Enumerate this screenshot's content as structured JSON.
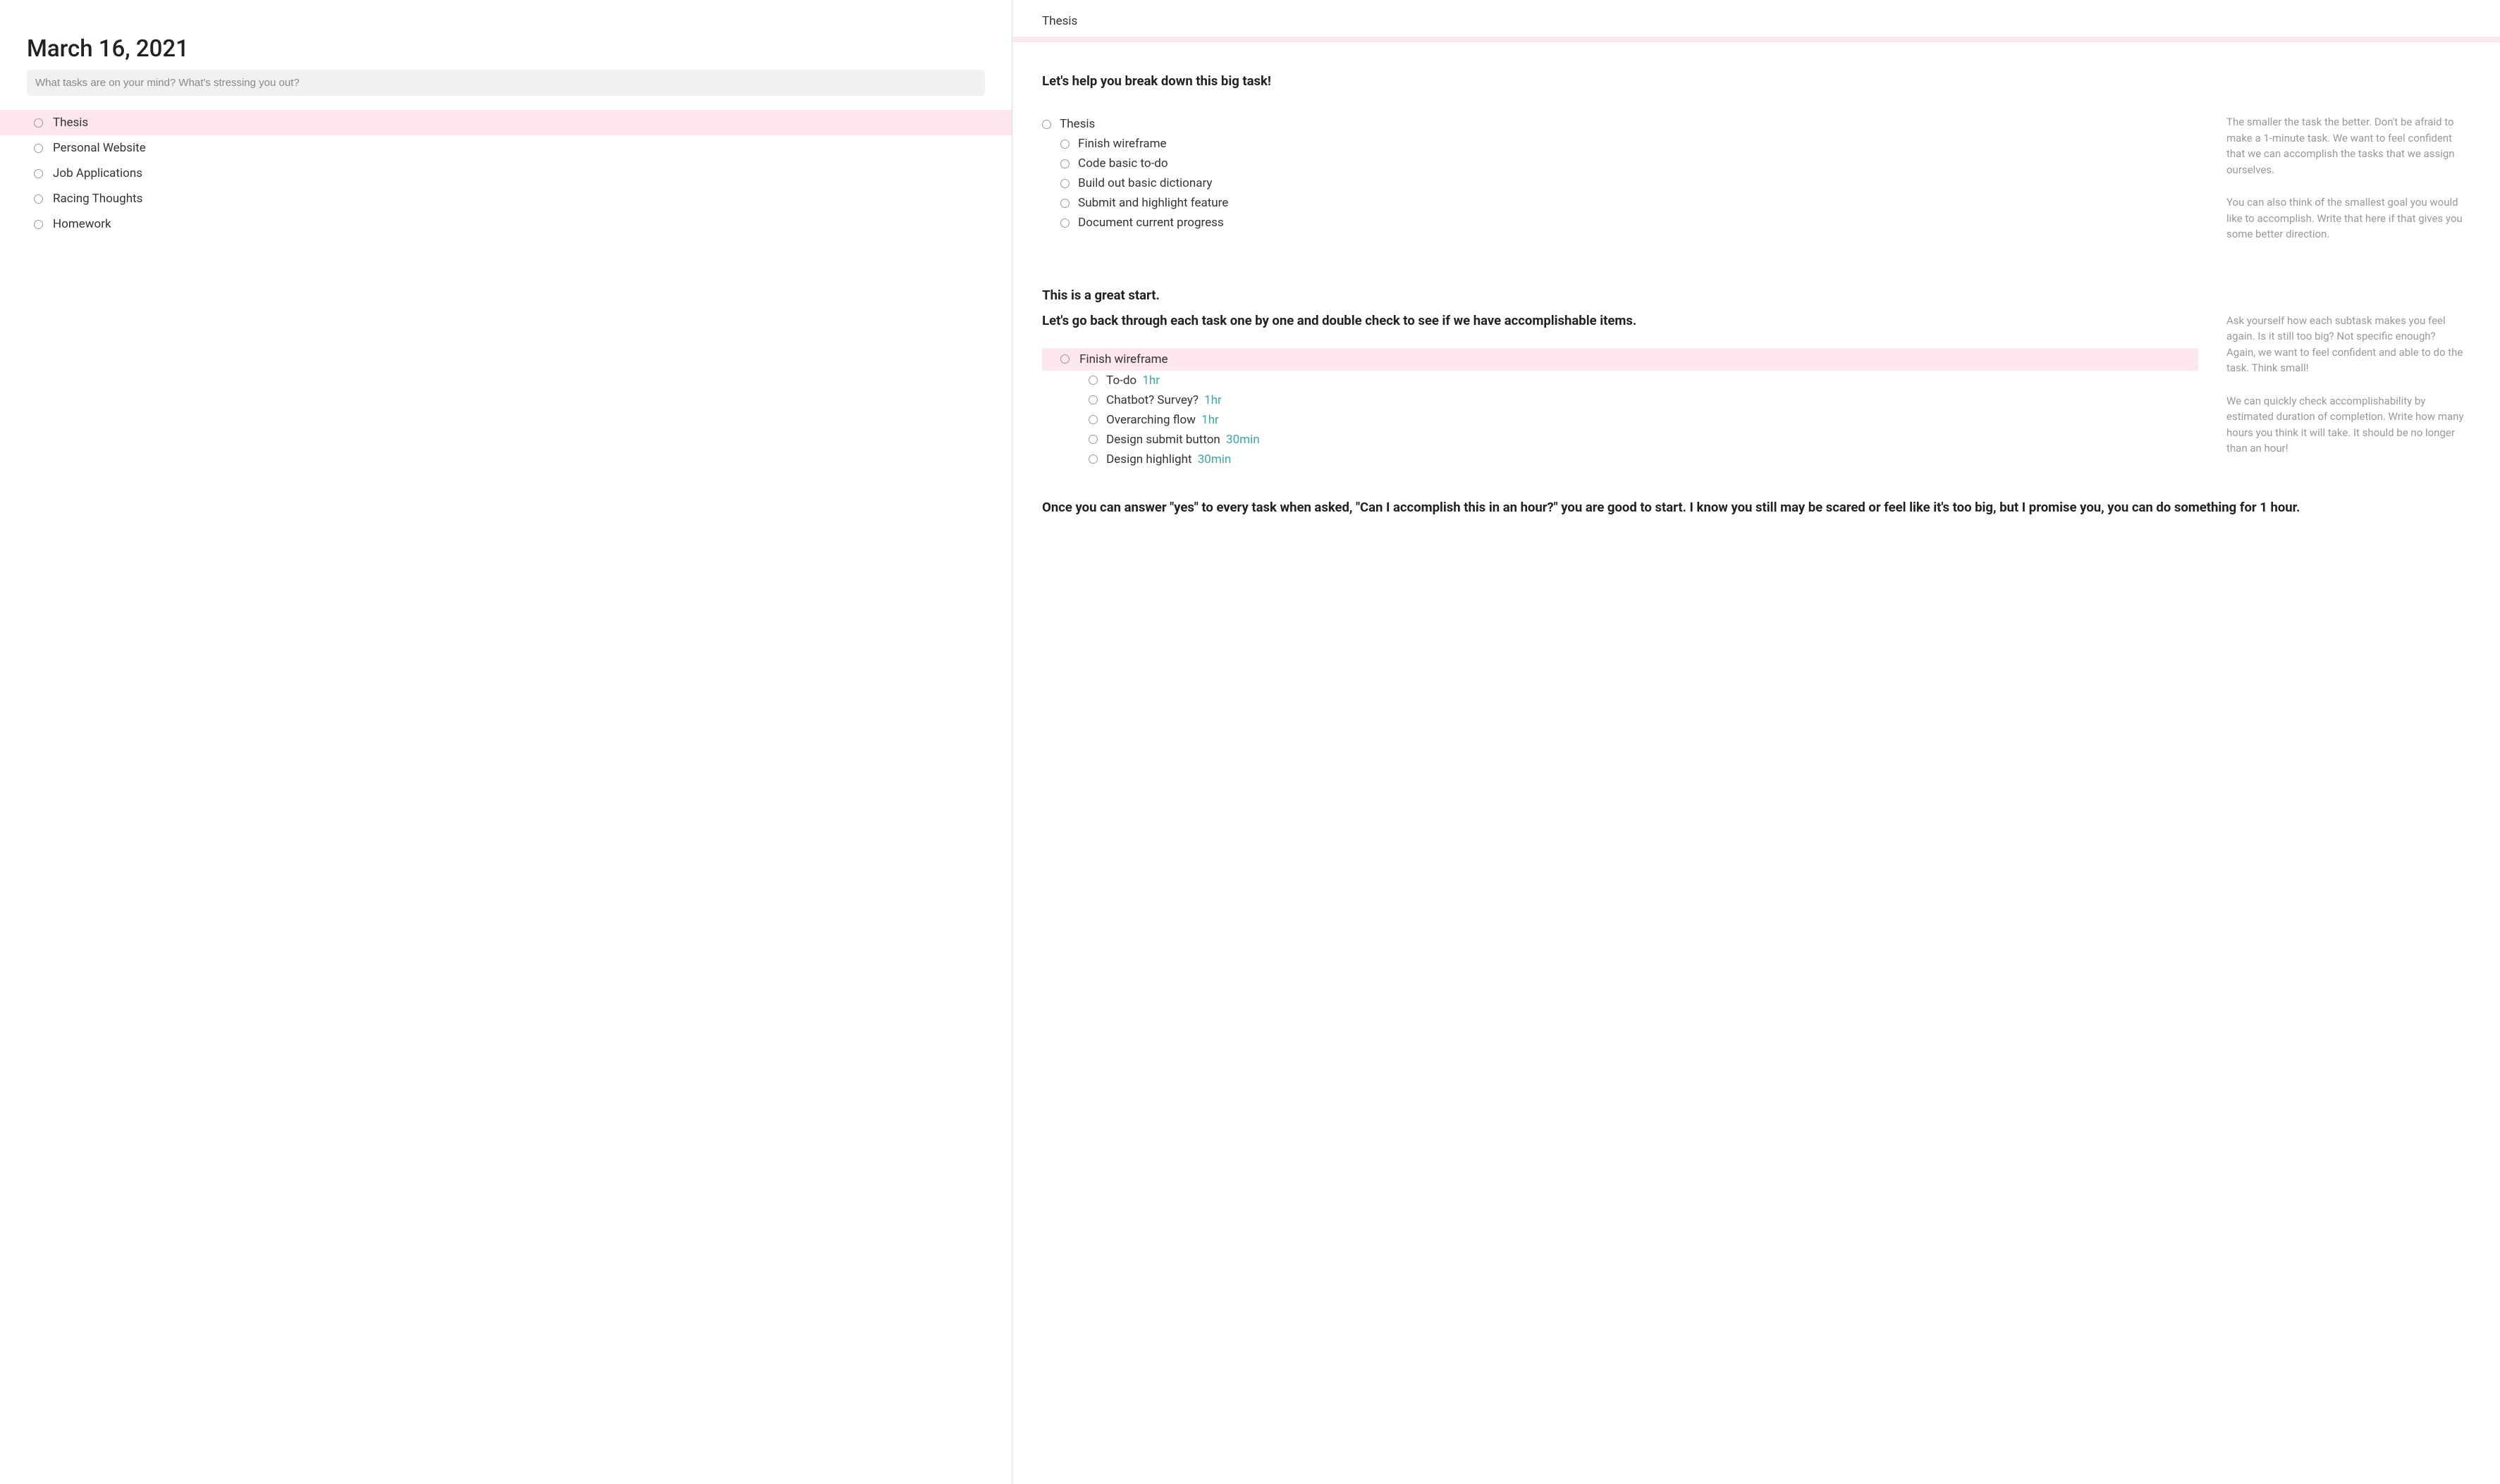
{
  "date": "March 16, 2021",
  "input_placeholder": "What tasks are on your mind? What's stressing you out?",
  "sidebar_tasks": [
    {
      "label": "Thesis",
      "selected": true
    },
    {
      "label": "Personal Website",
      "selected": false
    },
    {
      "label": "Job Applications",
      "selected": false
    },
    {
      "label": "Racing Thoughts",
      "selected": false
    },
    {
      "label": "Homework",
      "selected": false
    }
  ],
  "right_header": "Thesis",
  "section1": {
    "heading": "Let's help you break down this big task!",
    "parent": "Thesis",
    "subtasks": [
      "Finish wireframe",
      "Code basic to-do",
      "Build out basic dictionary",
      "Submit and highlight feature",
      "Document current progress"
    ],
    "hint1": "The smaller the task the better. Don't be afraid to make a 1-minute task. We want to feel confident that we can accomplish the tasks that we assign ourselves.",
    "hint2": "You can also think of the smallest goal you would like to accomplish. Write that here if that gives you some better direction."
  },
  "section2": {
    "heading1": "This is a great start.",
    "heading2": "Let's go back through each task one by one and double check to see if we have accomplishable items.",
    "hint1": "Ask yourself how each subtask makes you feel again. Is it still too big? Not specific enough? Again, we want to feel confident and able to do the task. Think small!",
    "hint2": "We can quickly check accomplishability by estimated duration of completion. Write how many hours you think it will take. It should be no longer than an hour!",
    "selected_task": "Finish wireframe",
    "subtasks": [
      {
        "label": "To-do",
        "duration": "1hr"
      },
      {
        "label": "Chatbot? Survey?",
        "duration": "1hr"
      },
      {
        "label": "Overarching flow",
        "duration": "1hr"
      },
      {
        "label": "Design submit button",
        "duration": "30min"
      },
      {
        "label": "Design highlight",
        "duration": "30min"
      }
    ]
  },
  "closing": "Once you can answer \"yes\" to every task when asked, \"Can I accomplish this in an hour?\" you are good to start. I know you still may be scared or feel like it's too big, but I promise you, you can do something for 1 hour."
}
